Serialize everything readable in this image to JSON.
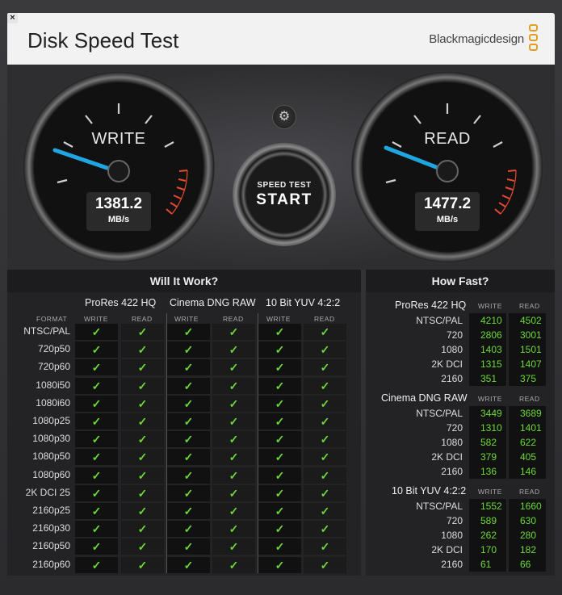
{
  "window": {
    "title": "Disk Speed Test",
    "close_glyph": "×"
  },
  "brand": {
    "name": "Blackmagicdesign",
    "logo_color": "#e3a020"
  },
  "gauges": {
    "write": {
      "label": "WRITE",
      "value": "1381.2",
      "unit": "MB/s"
    },
    "read": {
      "label": "READ",
      "value": "1477.2",
      "unit": "MB/s"
    }
  },
  "controls": {
    "settings_icon": "gear-icon",
    "start_top": "SPEED TEST",
    "start_main": "START"
  },
  "will_it_work": {
    "header": "Will It Work?",
    "format_label": "FORMAT",
    "groups": [
      {
        "title": "ProRes 422 HQ",
        "write": "WRITE",
        "read": "READ"
      },
      {
        "title": "Cinema DNG RAW",
        "write": "WRITE",
        "read": "READ"
      },
      {
        "title": "10 Bit YUV 4:2:2",
        "write": "WRITE",
        "read": "READ"
      }
    ],
    "check_glyph": "✓",
    "formats": [
      "NTSC/PAL",
      "720p50",
      "720p60",
      "1080i50",
      "1080i60",
      "1080p25",
      "1080p30",
      "1080p50",
      "1080p60",
      "2K DCI 25",
      "2160p25",
      "2160p30",
      "2160p50",
      "2160p60"
    ]
  },
  "how_fast": {
    "header": "How Fast?",
    "groups": [
      {
        "title": "ProRes 422 HQ",
        "write_label": "WRITE",
        "read_label": "READ",
        "rows": [
          {
            "label": "NTSC/PAL",
            "write": "4210",
            "read": "4502"
          },
          {
            "label": "720",
            "write": "2806",
            "read": "3001"
          },
          {
            "label": "1080",
            "write": "1403",
            "read": "1501"
          },
          {
            "label": "2K DCI",
            "write": "1315",
            "read": "1407"
          },
          {
            "label": "2160",
            "write": "351",
            "read": "375"
          }
        ]
      },
      {
        "title": "Cinema DNG RAW",
        "write_label": "WRITE",
        "read_label": "READ",
        "rows": [
          {
            "label": "NTSC/PAL",
            "write": "3449",
            "read": "3689"
          },
          {
            "label": "720",
            "write": "1310",
            "read": "1401"
          },
          {
            "label": "1080",
            "write": "582",
            "read": "622"
          },
          {
            "label": "2K DCI",
            "write": "379",
            "read": "405"
          },
          {
            "label": "2160",
            "write": "136",
            "read": "146"
          }
        ]
      },
      {
        "title": "10 Bit YUV 4:2:2",
        "write_label": "WRITE",
        "read_label": "READ",
        "rows": [
          {
            "label": "NTSC/PAL",
            "write": "1552",
            "read": "1660"
          },
          {
            "label": "720",
            "write": "589",
            "read": "630"
          },
          {
            "label": "1080",
            "write": "262",
            "read": "280"
          },
          {
            "label": "2K DCI",
            "write": "170",
            "read": "182"
          },
          {
            "label": "2160",
            "write": "61",
            "read": "66"
          }
        ]
      }
    ]
  }
}
